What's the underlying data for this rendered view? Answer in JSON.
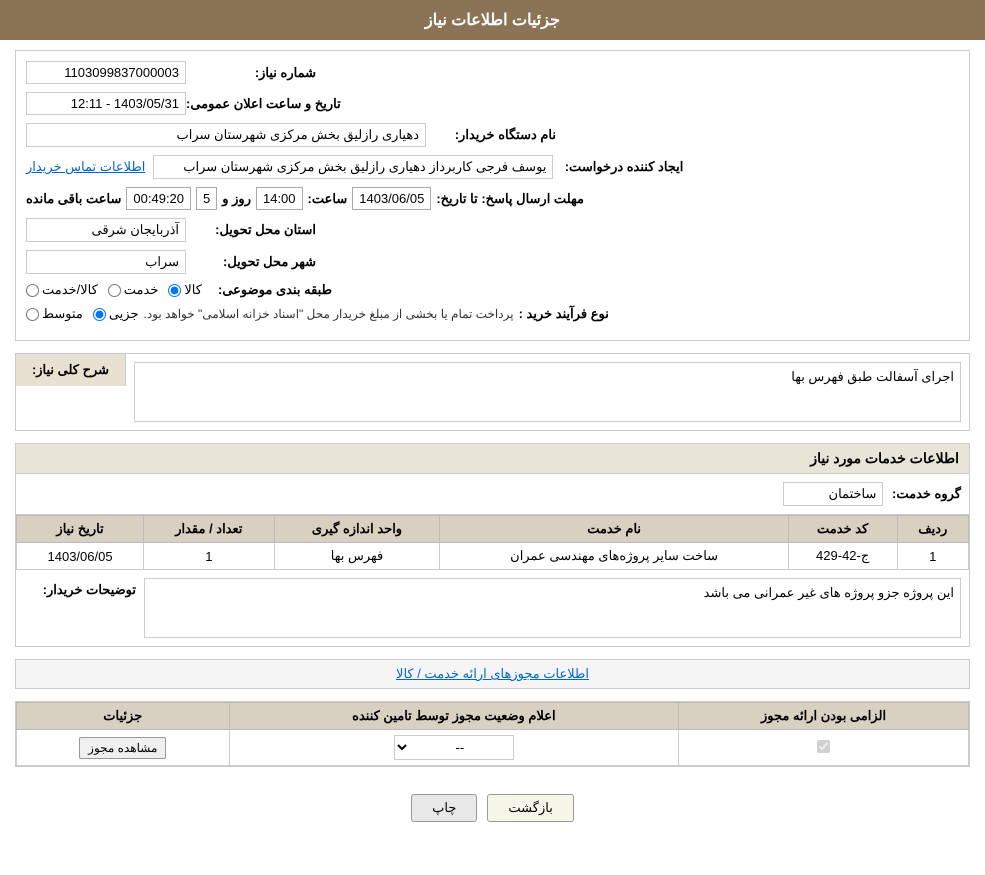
{
  "page": {
    "title": "جزئیات اطلاعات نیاز"
  },
  "header": {
    "title": "جزئیات اطلاعات نیاز"
  },
  "need_info": {
    "need_number_label": "شماره نیاز:",
    "need_number_value": "1103099837000003",
    "buyer_org_label": "نام دستگاه خریدار:",
    "buyer_org_value": "دهیاری رازلیق بخش مرکزی شهرستان سراب",
    "requester_label": "ایجاد کننده درخواست:",
    "requester_value": "یوسف فرجی کاربرداز دهیاری رازلیق بخش مرکزی شهرستان سراب",
    "requester_link": "اطلاعات تماس خریدار",
    "deadline_label": "مهلت ارسال پاسخ: تا تاریخ:",
    "deadline_date": "1403/06/05",
    "deadline_time_label": "ساعت:",
    "deadline_time": "14:00",
    "deadline_days_label": "روز و",
    "deadline_days": "5",
    "deadline_remain_label": "ساعت باقی مانده",
    "deadline_remain_time": "00:49:20",
    "announcement_date_label": "تاریخ و ساعت اعلان عمومی:",
    "announcement_date_value": "1403/05/31 - 12:11",
    "province_label": "استان محل تحویل:",
    "province_value": "آذربایجان شرقی",
    "city_label": "شهر محل تحویل:",
    "city_value": "سراب",
    "category_label": "طبقه بندی موضوعی:",
    "category_options": [
      "کالا",
      "خدمت",
      "کالا/خدمت"
    ],
    "category_selected": "کالا",
    "process_label": "نوع فرآیند خرید :",
    "process_options": [
      "جزیی",
      "متوسط"
    ],
    "process_selected": "جزیی",
    "process_note": "پرداخت تمام یا بخشی از مبلغ خریدار محل \"اسناد خزانه اسلامی\" خواهد بود."
  },
  "general_description": {
    "section_title": "شرح کلی نیاز:",
    "value": "اجرای آسفالت طبق فهرس بها"
  },
  "services_info": {
    "section_title": "اطلاعات خدمات مورد نیاز",
    "service_group_label": "گروه خدمت:",
    "service_group_value": "ساختمان",
    "table": {
      "headers": [
        "ردیف",
        "کد خدمت",
        "نام خدمت",
        "واحد اندازه گیری",
        "تعداد / مقدار",
        "تاریخ نیاز"
      ],
      "rows": [
        {
          "row": "1",
          "code": "ج-42-429",
          "name": "ساخت سایر پروژه‌های مهندسی عمران",
          "unit": "فهرس بها",
          "quantity": "1",
          "date": "1403/06/05"
        }
      ]
    },
    "buyer_notes_label": "توضیحات خریدار:",
    "buyer_notes_value": "این پروژه جزو پروژه های غیر عمرانی می باشد"
  },
  "license_info": {
    "section_link": "اطلاعات مجوزهای ارائه خدمت / کالا",
    "table": {
      "headers": [
        "الزامی بودن ارائه مجوز",
        "اعلام وضعیت مجوز توسط تامین کننده",
        "جزئیات"
      ],
      "rows": [
        {
          "required": "✓",
          "status": "--",
          "details": "مشاهده مجوز"
        }
      ]
    }
  },
  "buttons": {
    "print": "چاپ",
    "back": "بازگشت"
  }
}
